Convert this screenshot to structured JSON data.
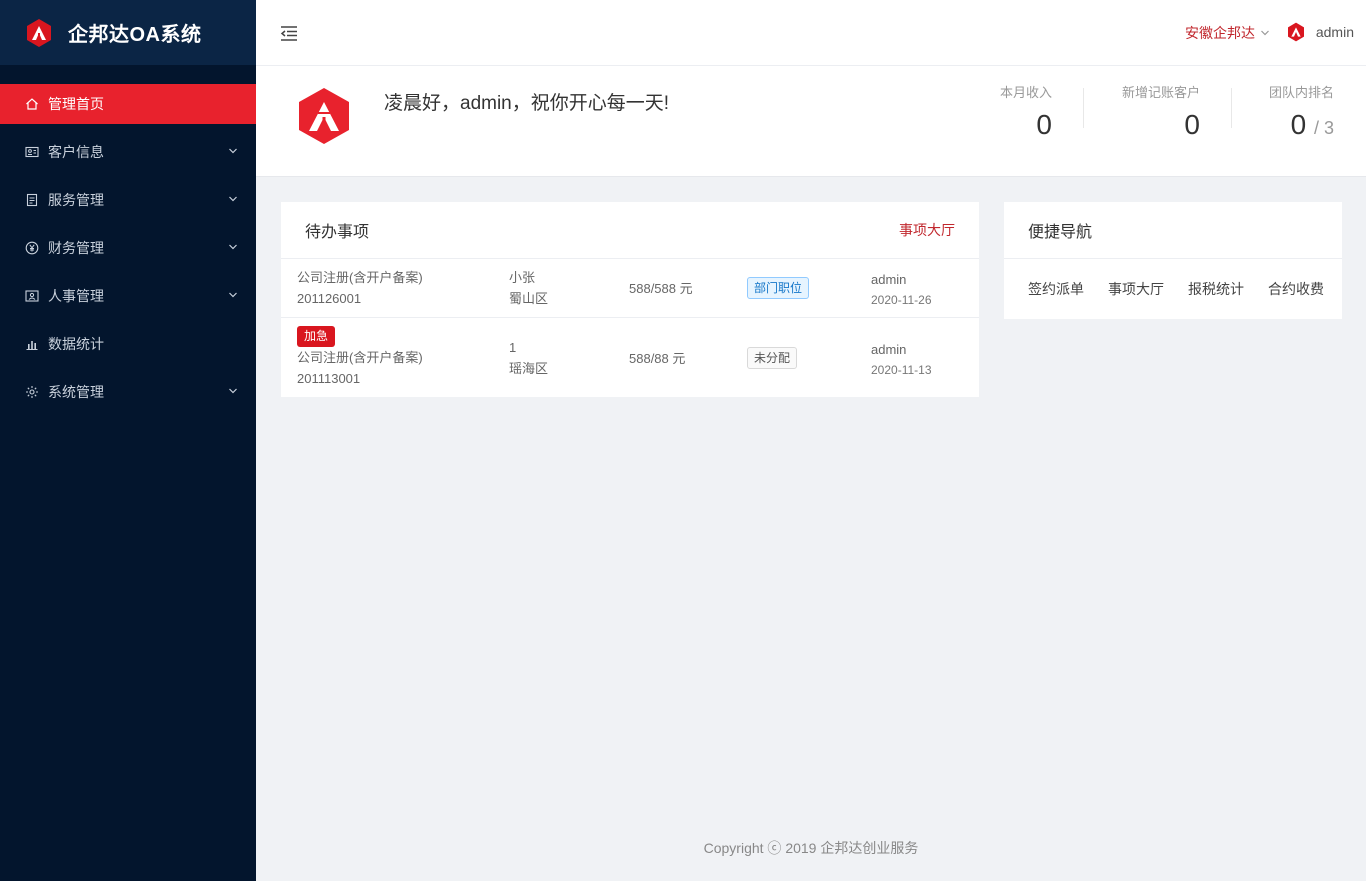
{
  "app": {
    "title": "企邦达OA系统"
  },
  "sidebar": {
    "items": [
      {
        "label": "管理首页",
        "icon": "home-icon",
        "active": true
      },
      {
        "label": "客户信息",
        "icon": "id-card-icon"
      },
      {
        "label": "服务管理",
        "icon": "clipboard-icon"
      },
      {
        "label": "财务管理",
        "icon": "yuan-icon"
      },
      {
        "label": "人事管理",
        "icon": "person-card-icon"
      },
      {
        "label": "数据统计",
        "icon": "bar-chart-icon"
      },
      {
        "label": "系统管理",
        "icon": "gear-icon"
      }
    ]
  },
  "header": {
    "company": "安徽企邦达",
    "user": "admin"
  },
  "welcome": {
    "greeting": "凌晨好，admin，祝你开心每一天!",
    "stats": [
      {
        "label": "本月收入",
        "value": "0"
      },
      {
        "label": "新增记账客户",
        "value": "0"
      },
      {
        "label": "团队内排名",
        "value": "0",
        "sub": "/ 3"
      }
    ]
  },
  "todo": {
    "title": "待办事项",
    "link": "事项大厅",
    "rows": [
      {
        "service": "公司注册(含开户备案)",
        "code": "201126001",
        "person": "小张",
        "district": "蜀山区",
        "amount": "588/588 元",
        "tag": "部门职位",
        "owner": "admin",
        "date": "2020-11-26"
      },
      {
        "urgent": "加急",
        "service": "公司注册(含开户备案)",
        "code": "201113001",
        "person": "1",
        "district": "瑶海区",
        "amount": "588/88 元",
        "tag": "未分配",
        "owner": "admin",
        "date": "2020-11-13"
      }
    ]
  },
  "quicknav": {
    "title": "便捷导航",
    "links": [
      "签约派单",
      "事项大厅",
      "报税统计",
      "合约收费"
    ]
  },
  "footer": {
    "copyright": "Copyright ⓒ 2019 企邦达创业服务"
  },
  "colors": {
    "sidebar_bg": "#03152d",
    "brand_bg": "#0b2545",
    "accent": "#e8222d",
    "link": "#c1272d"
  }
}
